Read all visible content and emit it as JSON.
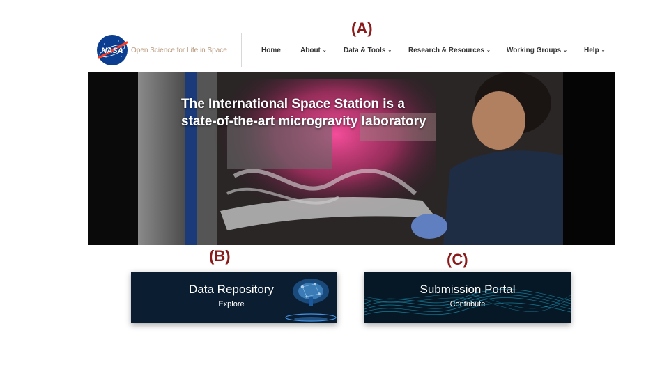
{
  "annotations": {
    "a": "(A)",
    "b": "(B)",
    "c": "(C)"
  },
  "header": {
    "logo_icon": "nasa-meatball-icon",
    "logo_text": "NASA",
    "site_name": "Open Science for Life in Space",
    "nav": [
      {
        "label": "Home",
        "dropdown": false
      },
      {
        "label": "About",
        "dropdown": true
      },
      {
        "label": "Data & Tools",
        "dropdown": true
      },
      {
        "label": "Research & Resources",
        "dropdown": true
      },
      {
        "label": "Working Groups",
        "dropdown": true
      },
      {
        "label": "Help",
        "dropdown": true
      }
    ],
    "chevron_glyph": "⌄"
  },
  "hero": {
    "line1": "The International Space Station is a",
    "line2": "state-of-the-art microgravity laboratory"
  },
  "cards": {
    "data_repository": {
      "title": "Data Repository",
      "subtitle": "Explore"
    },
    "submission_portal": {
      "title": "Submission Portal",
      "subtitle": "Contribute"
    }
  },
  "colors": {
    "annotation": "#8b1a1a",
    "nasa_blue": "#0b3d91",
    "nasa_red": "#fc3d21",
    "hero_pink": "#e0307a",
    "card_bg": "#0a1a2a"
  }
}
